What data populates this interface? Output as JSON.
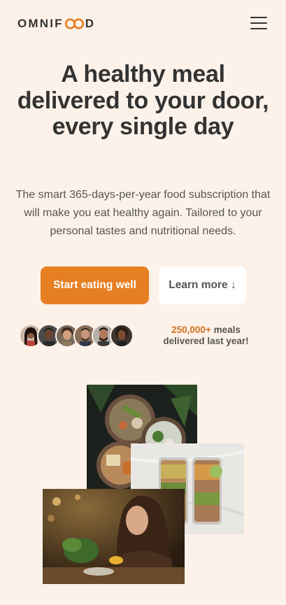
{
  "header": {
    "logo_text_before": "OMNIF",
    "logo_text_after": "D",
    "logo_accent": "#e67e22",
    "menu_icon": "hamburger-menu-icon"
  },
  "hero": {
    "title": "A healthy meal delivered to your door, every single day",
    "description": "The smart 365-days-per-year food subscription that will make you eat healthy again. Tailored to your personal tastes and nutritional needs.",
    "primary_cta": "Start eating well",
    "secondary_cta": "Learn more ↓"
  },
  "social_proof": {
    "avatar_count": 6,
    "meals_count": "250,000+",
    "meals_text": "meals delivered last year!"
  },
  "images": [
    {
      "name": "food-bowls-photo"
    },
    {
      "name": "meal-prep-containers-photo"
    },
    {
      "name": "woman-eating-photo"
    }
  ],
  "colors": {
    "background": "#fdf2e9",
    "primary": "#e67e22",
    "text": "#333333"
  }
}
